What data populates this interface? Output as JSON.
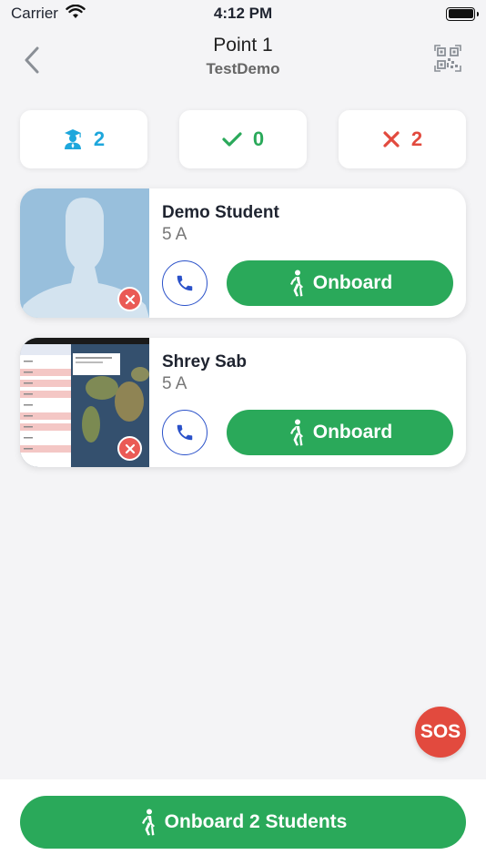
{
  "status_bar": {
    "carrier": "Carrier",
    "time": "4:12 PM"
  },
  "header": {
    "title": "Point 1",
    "subtitle": "TestDemo"
  },
  "stats": {
    "total": {
      "value": "2",
      "icon": "student-graduate-icon",
      "color": "#1ea7dc"
    },
    "onboarded": {
      "value": "0",
      "icon": "checkmark-icon",
      "color": "#2aa95a"
    },
    "absent": {
      "value": "2",
      "icon": "x-icon",
      "color": "#e24a3e"
    }
  },
  "students": [
    {
      "name": "Demo Student",
      "class": "5 A",
      "onboard_label": "Onboard",
      "photo": "avatar-placeholder"
    },
    {
      "name": "Shrey Sab",
      "class": "5 A",
      "onboard_label": "Onboard",
      "photo": "screenshot-thumbnail"
    }
  ],
  "sos_label": "SOS",
  "bottom": {
    "onboard_all_label": "Onboard 2 Students"
  },
  "colors": {
    "green": "#2aa95a",
    "red": "#e24a3e",
    "blue": "#2a51c9",
    "accent_blue": "#1ea7dc"
  }
}
